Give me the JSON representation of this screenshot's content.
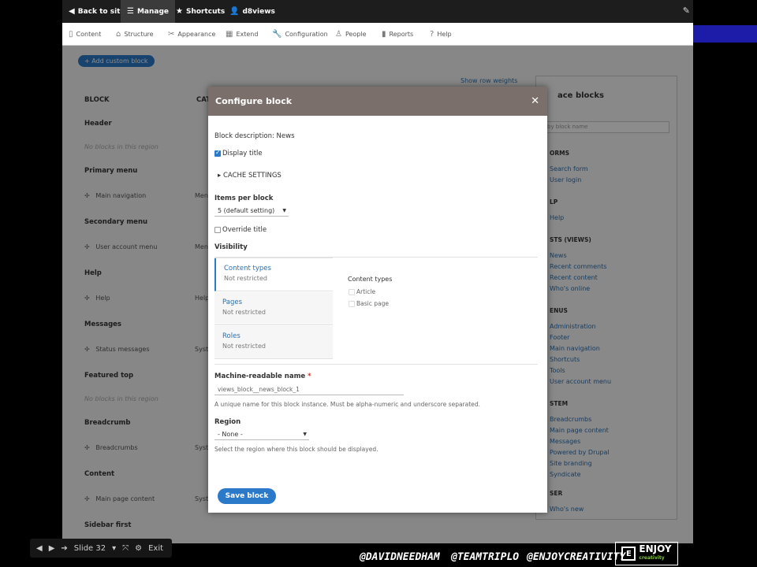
{
  "toolbar": {
    "back_label": "Back to site",
    "manage_label": "Manage",
    "shortcuts_label": "Shortcuts",
    "user_label": "d8views"
  },
  "admin_nav": [
    {
      "label": "Content",
      "icon": "file-icon"
    },
    {
      "label": "Structure",
      "icon": "structure-icon"
    },
    {
      "label": "Appearance",
      "icon": "appearance-icon"
    },
    {
      "label": "Extend",
      "icon": "puzzle-icon"
    },
    {
      "label": "Configuration",
      "icon": "wrench-icon"
    },
    {
      "label": "People",
      "icon": "person-icon"
    },
    {
      "label": "Reports",
      "icon": "chart-icon"
    },
    {
      "label": "Help",
      "icon": "help-icon"
    }
  ],
  "background_page": {
    "add_custom_block": "+ Add custom block",
    "show_row_weights": "Show row weights",
    "block_col": "BLOCK",
    "category_col": "CAT",
    "regions": [
      {
        "name": "Header",
        "item": "No blocks in this region",
        "cat": ""
      },
      {
        "name": "Primary menu",
        "item": "Main navigation",
        "cat": "Men"
      },
      {
        "name": "Secondary menu",
        "item": "User account menu",
        "cat": "Men"
      },
      {
        "name": "Help",
        "item": "Help",
        "cat": "Help"
      },
      {
        "name": "Messages",
        "item": "Status messages",
        "cat": "Syst"
      },
      {
        "name": "Featured top",
        "item": "No blocks in this region",
        "cat": ""
      },
      {
        "name": "Breadcrumb",
        "item": "Breadcrumbs",
        "cat": "Syst"
      },
      {
        "name": "Content",
        "item": "Main page content",
        "cat": "Syst"
      },
      {
        "name": "Sidebar first",
        "item": "",
        "cat": ""
      }
    ],
    "place_blocks": {
      "title": "ace blocks",
      "filter_placeholder": "by block name",
      "groups": [
        {
          "heading": "ORMS",
          "links": [
            "Search form",
            "User login"
          ]
        },
        {
          "heading": "LP",
          "links": [
            "Help"
          ]
        },
        {
          "heading": "STS (VIEWS)",
          "links": [
            "News",
            "Recent comments",
            "Recent content",
            "Who's online"
          ]
        },
        {
          "heading": "ENUS",
          "links": [
            "Administration",
            "Footer",
            "Main navigation",
            "Shortcuts",
            "Tools",
            "User account menu"
          ]
        },
        {
          "heading": "STEM",
          "links": [
            "Breadcrumbs",
            "Main page content",
            "Messages",
            "Powered by Drupal",
            "Site branding",
            "Syndicate"
          ]
        },
        {
          "heading": "SER",
          "links": [
            "Who's new"
          ]
        }
      ]
    }
  },
  "dialog": {
    "title": "Configure block",
    "block_description_label": "Block description:",
    "block_description_value": "News",
    "display_title_label": "Display title",
    "display_title_checked": true,
    "cache_settings_label": "CACHE SETTINGS",
    "items_per_block_label": "Items per block",
    "items_per_block_value": "5 (default setting)",
    "override_title_label": "Override title",
    "visibility_label": "Visibility",
    "vertical_tabs": [
      {
        "title": "Content types",
        "summary": "Not restricted",
        "active": true
      },
      {
        "title": "Pages",
        "summary": "Not restricted",
        "active": false
      },
      {
        "title": "Roles",
        "summary": "Not restricted",
        "active": false
      }
    ],
    "content_types_heading": "Content types",
    "content_type_options": [
      "Article",
      "Basic page"
    ],
    "machine_name_label": "Machine-readable name",
    "machine_name_required": "*",
    "machine_name_value": "views_block__news_block_1",
    "machine_name_help": "A unique name for this block instance. Must be alpha-numeric and underscore separated.",
    "region_label": "Region",
    "region_value": "- None -",
    "region_help": "Select the region where this block should be displayed.",
    "save_label": "Save block"
  },
  "slide_controls": {
    "slide_label": "Slide 32",
    "exit_label": "Exit"
  },
  "handles": [
    "@DAVIDNEEDHAM",
    "@TEAMTRIPLO",
    "@ENJOYCREATIVITY"
  ],
  "logo": {
    "mark": "E",
    "word": "ENJOY",
    "sub": "creativity"
  },
  "colors": {
    "accent": "#2a7ac9",
    "toolbar": "#1d1d1d",
    "dialog_header": "#7a6f6b"
  }
}
